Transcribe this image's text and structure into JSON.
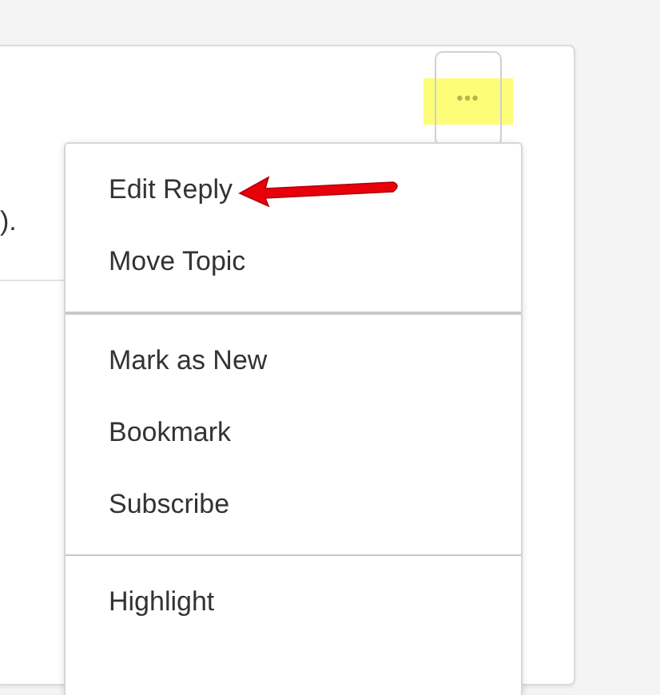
{
  "post": {
    "text_fragment": ")."
  },
  "more_button": {
    "label": "•••",
    "highlighted": true
  },
  "menu": {
    "groups": [
      {
        "items": [
          {
            "label": "Edit Reply",
            "annotated": true
          },
          {
            "label": "Move Topic",
            "annotated": false
          }
        ]
      },
      {
        "items": [
          {
            "label": "Mark as New",
            "annotated": false
          },
          {
            "label": "Bookmark",
            "annotated": false
          },
          {
            "label": "Subscribe",
            "annotated": false
          }
        ]
      },
      {
        "items": [
          {
            "label": "Highlight",
            "annotated": false
          }
        ]
      }
    ]
  }
}
